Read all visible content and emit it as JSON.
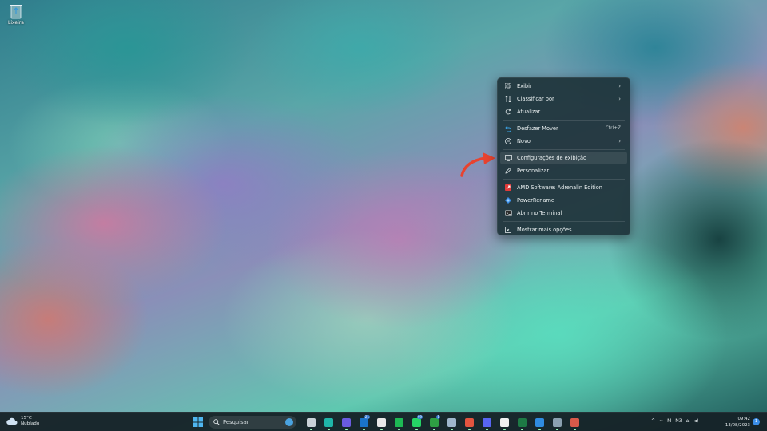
{
  "desktop": {
    "recycle_bin_label": "Lixeira"
  },
  "context_menu": {
    "items": [
      {
        "label": "Exibir",
        "icon": "grid-view-icon",
        "submenu": true
      },
      {
        "label": "Classificar por",
        "icon": "sort-icon",
        "submenu": true
      },
      {
        "label": "Atualizar",
        "icon": "refresh-icon"
      },
      {
        "label": "Desfazer Mover",
        "icon": "undo-icon",
        "shortcut": "Ctrl+Z"
      },
      {
        "label": "Novo",
        "icon": "new-plus-icon",
        "submenu": true
      },
      {
        "label": "Configurações de exibição",
        "icon": "display-settings-icon",
        "highlighted": true
      },
      {
        "label": "Personalizar",
        "icon": "pencil-icon"
      },
      {
        "label": "AMD Software: Adrenalin Edition",
        "icon": "amd-icon"
      },
      {
        "label": "PowerRename",
        "icon": "powerrename-icon"
      },
      {
        "label": "Abrir no Terminal",
        "icon": "terminal-icon"
      },
      {
        "label": "Mostrar mais opções",
        "icon": "more-options-icon"
      }
    ],
    "submenu_glyph": "›"
  },
  "taskbar": {
    "weather": {
      "temp": "15°C",
      "condition": "Nublado",
      "icon": "cloud-icon"
    },
    "search_placeholder": "Pesquisar",
    "apps": [
      {
        "name": "file-explorer-icon",
        "color": "#c9d2d8"
      },
      {
        "name": "edge-icon",
        "color": "#1fb5a8"
      },
      {
        "name": "media-player-icon",
        "color": "#6a5be0"
      },
      {
        "name": "outlook-icon",
        "color": "#1a73c8",
        "badge": "21"
      },
      {
        "name": "notion-icon",
        "color": "#e8e8e8"
      },
      {
        "name": "spotify-icon",
        "color": "#1db954"
      },
      {
        "name": "whatsapp-icon",
        "color": "#25d366",
        "badge": "99"
      },
      {
        "name": "xbox-icon",
        "color": "#2ea043",
        "badge": "1"
      },
      {
        "name": "steam-icon",
        "color": "#9fb6cc"
      },
      {
        "name": "game-controller-icon",
        "color": "#e2543f"
      },
      {
        "name": "discord-icon",
        "color": "#5865f2"
      },
      {
        "name": "capcut-icon",
        "color": "#f0f0f0"
      },
      {
        "name": "excel-icon",
        "color": "#1d7a45"
      },
      {
        "name": "vscode-icon",
        "color": "#2f8be0"
      },
      {
        "name": "settings-icon",
        "color": "#8aa0b0"
      },
      {
        "name": "snipping-tool-icon",
        "color": "#d85a4a"
      }
    ],
    "tray_text": [
      "^",
      "~",
      "M",
      "N3",
      "⌂",
      "◄)"
    ],
    "time": "09:42",
    "date": "13/08/2023",
    "notification_count": "1"
  },
  "colors": {
    "menu_bg": "#1e343a",
    "arrow": "#e8432f",
    "amd_red": "#e03a3a",
    "powerrename_blue": "#3a8ee8"
  }
}
